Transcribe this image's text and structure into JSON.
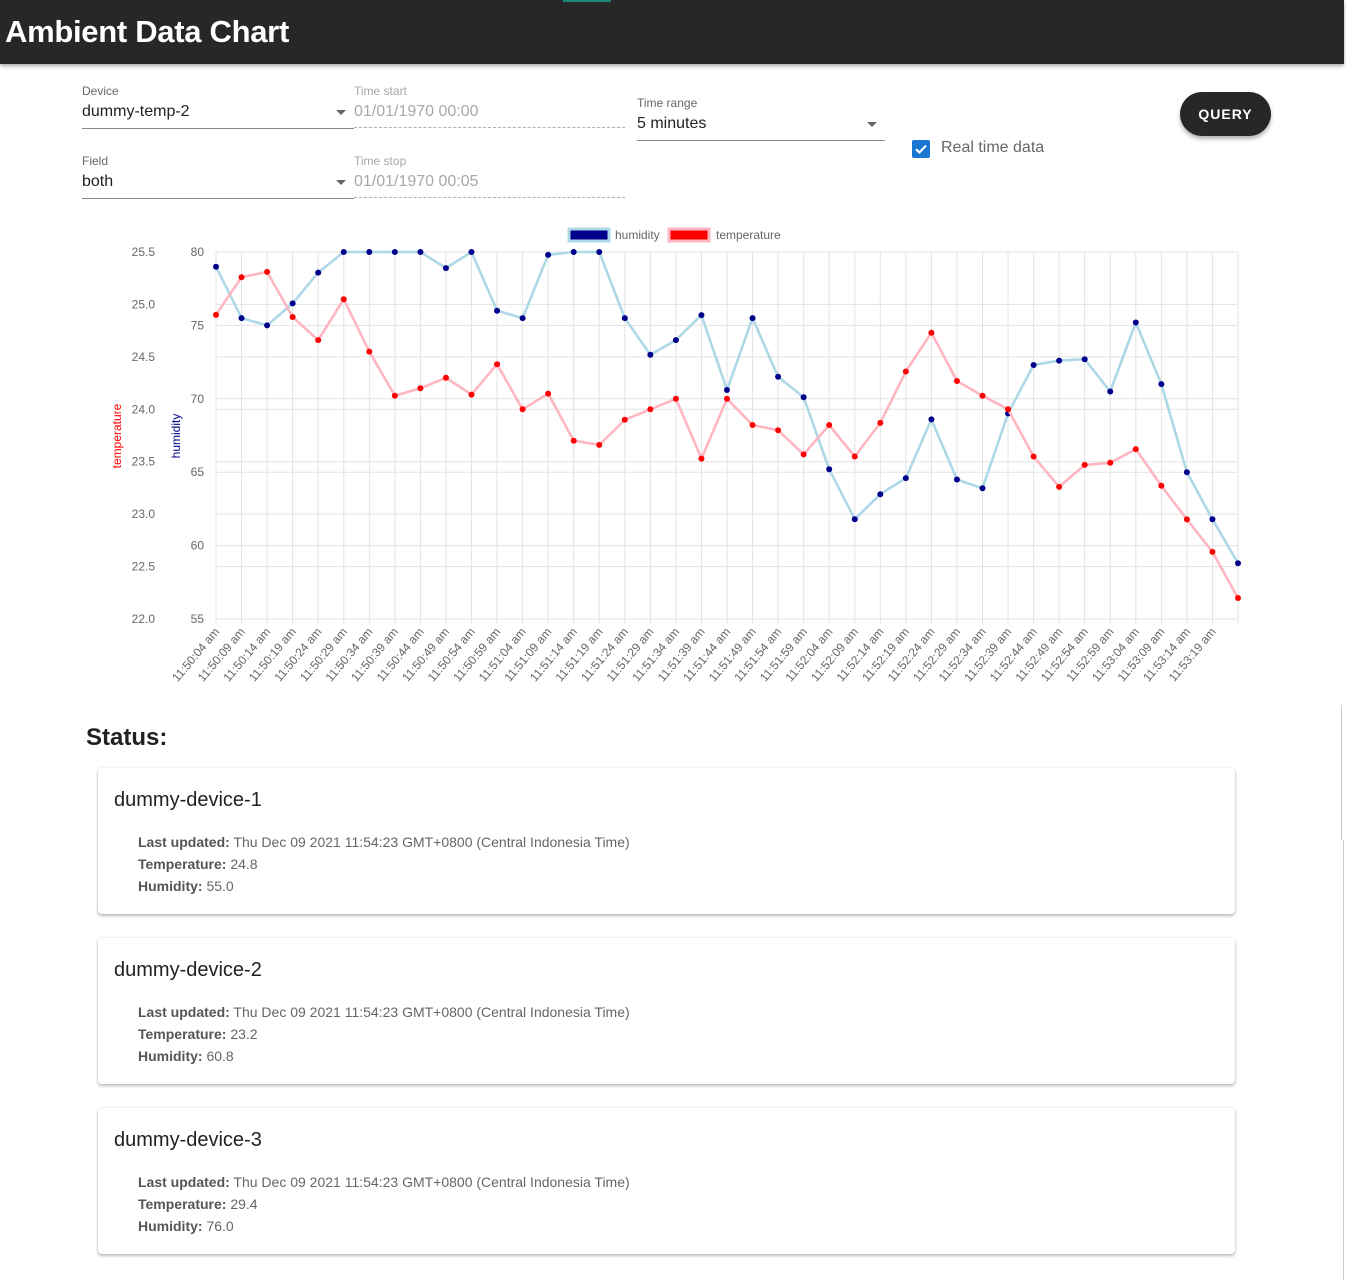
{
  "app": {
    "title": "Ambient Data Chart"
  },
  "form": {
    "device": {
      "label": "Device",
      "value": "dummy-temp-2"
    },
    "field": {
      "label": "Field",
      "value": "both"
    },
    "time_start": {
      "label": "Time start",
      "value": "01/01/1970 00:00"
    },
    "time_stop": {
      "label": "Time stop",
      "value": "01/01/1970 00:05"
    },
    "time_range": {
      "label": "Time range",
      "value": "5 minutes"
    },
    "query_label": "QUERY",
    "realtime": {
      "label": "Real time data",
      "checked": true
    }
  },
  "chart_data": {
    "type": "line",
    "x": [
      "11:50:04 am",
      "11:50:09 am",
      "11:50:14 am",
      "11:50:19 am",
      "11:50:24 am",
      "11:50:29 am",
      "11:50:34 am",
      "11:50:39 am",
      "11:50:44 am",
      "11:50:49 am",
      "11:50:54 am",
      "11:50:59 am",
      "11:51:04 am",
      "11:51:09 am",
      "11:51:14 am",
      "11:51:19 am",
      "11:51:24 am",
      "11:51:29 am",
      "11:51:34 am",
      "11:51:39 am",
      "11:51:44 am",
      "11:51:49 am",
      "11:51:54 am",
      "11:51:59 am",
      "11:52:04 am",
      "11:52:09 am",
      "11:52:14 am",
      "11:52:19 am",
      "11:52:24 am",
      "11:52:29 am",
      "11:52:34 am",
      "11:52:39 am",
      "11:52:44 am",
      "11:52:49 am",
      "11:52:54 am",
      "11:52:59 am",
      "11:53:04 am",
      "11:53:09 am",
      "11:53:14 am",
      "11:53:19 am"
    ],
    "series": [
      {
        "name": "humidity",
        "axis": "humidity",
        "line_color": "#add8e6",
        "point_color": "#00008b",
        "legend_color": "#00008b",
        "values": [
          79.0,
          75.5,
          75.0,
          76.5,
          78.6,
          80.0,
          80.0,
          80.0,
          80.0,
          78.9,
          80.0,
          76.0,
          75.5,
          79.8,
          80.0,
          80.0,
          75.5,
          73.0,
          74.0,
          75.7,
          70.6,
          75.5,
          71.5,
          70.1,
          65.2,
          61.8,
          63.5,
          64.6,
          68.6,
          64.5,
          63.9,
          69.0,
          72.3,
          72.6,
          72.7,
          70.5,
          75.2,
          71.0,
          65.0,
          61.8,
          58.8
        ]
      },
      {
        "name": "temperature",
        "axis": "temperature",
        "line_color": "#ffb6c1",
        "point_color": "#ff0000",
        "legend_color": "#ff0000",
        "values": [
          24.9,
          25.26,
          25.31,
          24.88,
          24.66,
          25.05,
          24.55,
          24.13,
          24.2,
          24.3,
          24.14,
          24.43,
          24.0,
          24.15,
          23.7,
          23.66,
          23.9,
          24.0,
          24.1,
          23.53,
          24.1,
          23.85,
          23.8,
          23.57,
          23.85,
          23.55,
          23.87,
          24.36,
          24.73,
          24.27,
          24.13,
          24.0,
          23.55,
          23.26,
          23.47,
          23.49,
          23.62,
          23.27,
          22.95,
          22.64,
          22.2
        ]
      }
    ],
    "axes": {
      "temperature": {
        "label": "temperature",
        "label_color": "#ff0000",
        "min": 22.0,
        "max": 25.5,
        "ticks": [
          "22.0",
          "22.5",
          "23.0",
          "23.5",
          "24.0",
          "24.5",
          "25.0",
          "25.5"
        ]
      },
      "humidity": {
        "label": "humidity",
        "label_color": "#00008b",
        "min": 55,
        "max": 80,
        "ticks": [
          "55",
          "60",
          "65",
          "70",
          "75",
          "80"
        ]
      }
    },
    "grid": true,
    "legend": "top-center"
  },
  "status": {
    "title": "Status:",
    "labels": {
      "updated": "Last updated:",
      "temperature": "Temperature:",
      "humidity": "Humidity:"
    },
    "devices": [
      {
        "name": "dummy-device-1",
        "updated": "Thu Dec 09 2021 11:54:23 GMT+0800 (Central Indonesia Time)",
        "temperature": "24.8",
        "humidity": "55.0"
      },
      {
        "name": "dummy-device-2",
        "updated": "Thu Dec 09 2021 11:54:23 GMT+0800 (Central Indonesia Time)",
        "temperature": "23.2",
        "humidity": "60.8"
      },
      {
        "name": "dummy-device-3",
        "updated": "Thu Dec 09 2021 11:54:23 GMT+0800 (Central Indonesia Time)",
        "temperature": "29.4",
        "humidity": "76.0"
      }
    ]
  }
}
